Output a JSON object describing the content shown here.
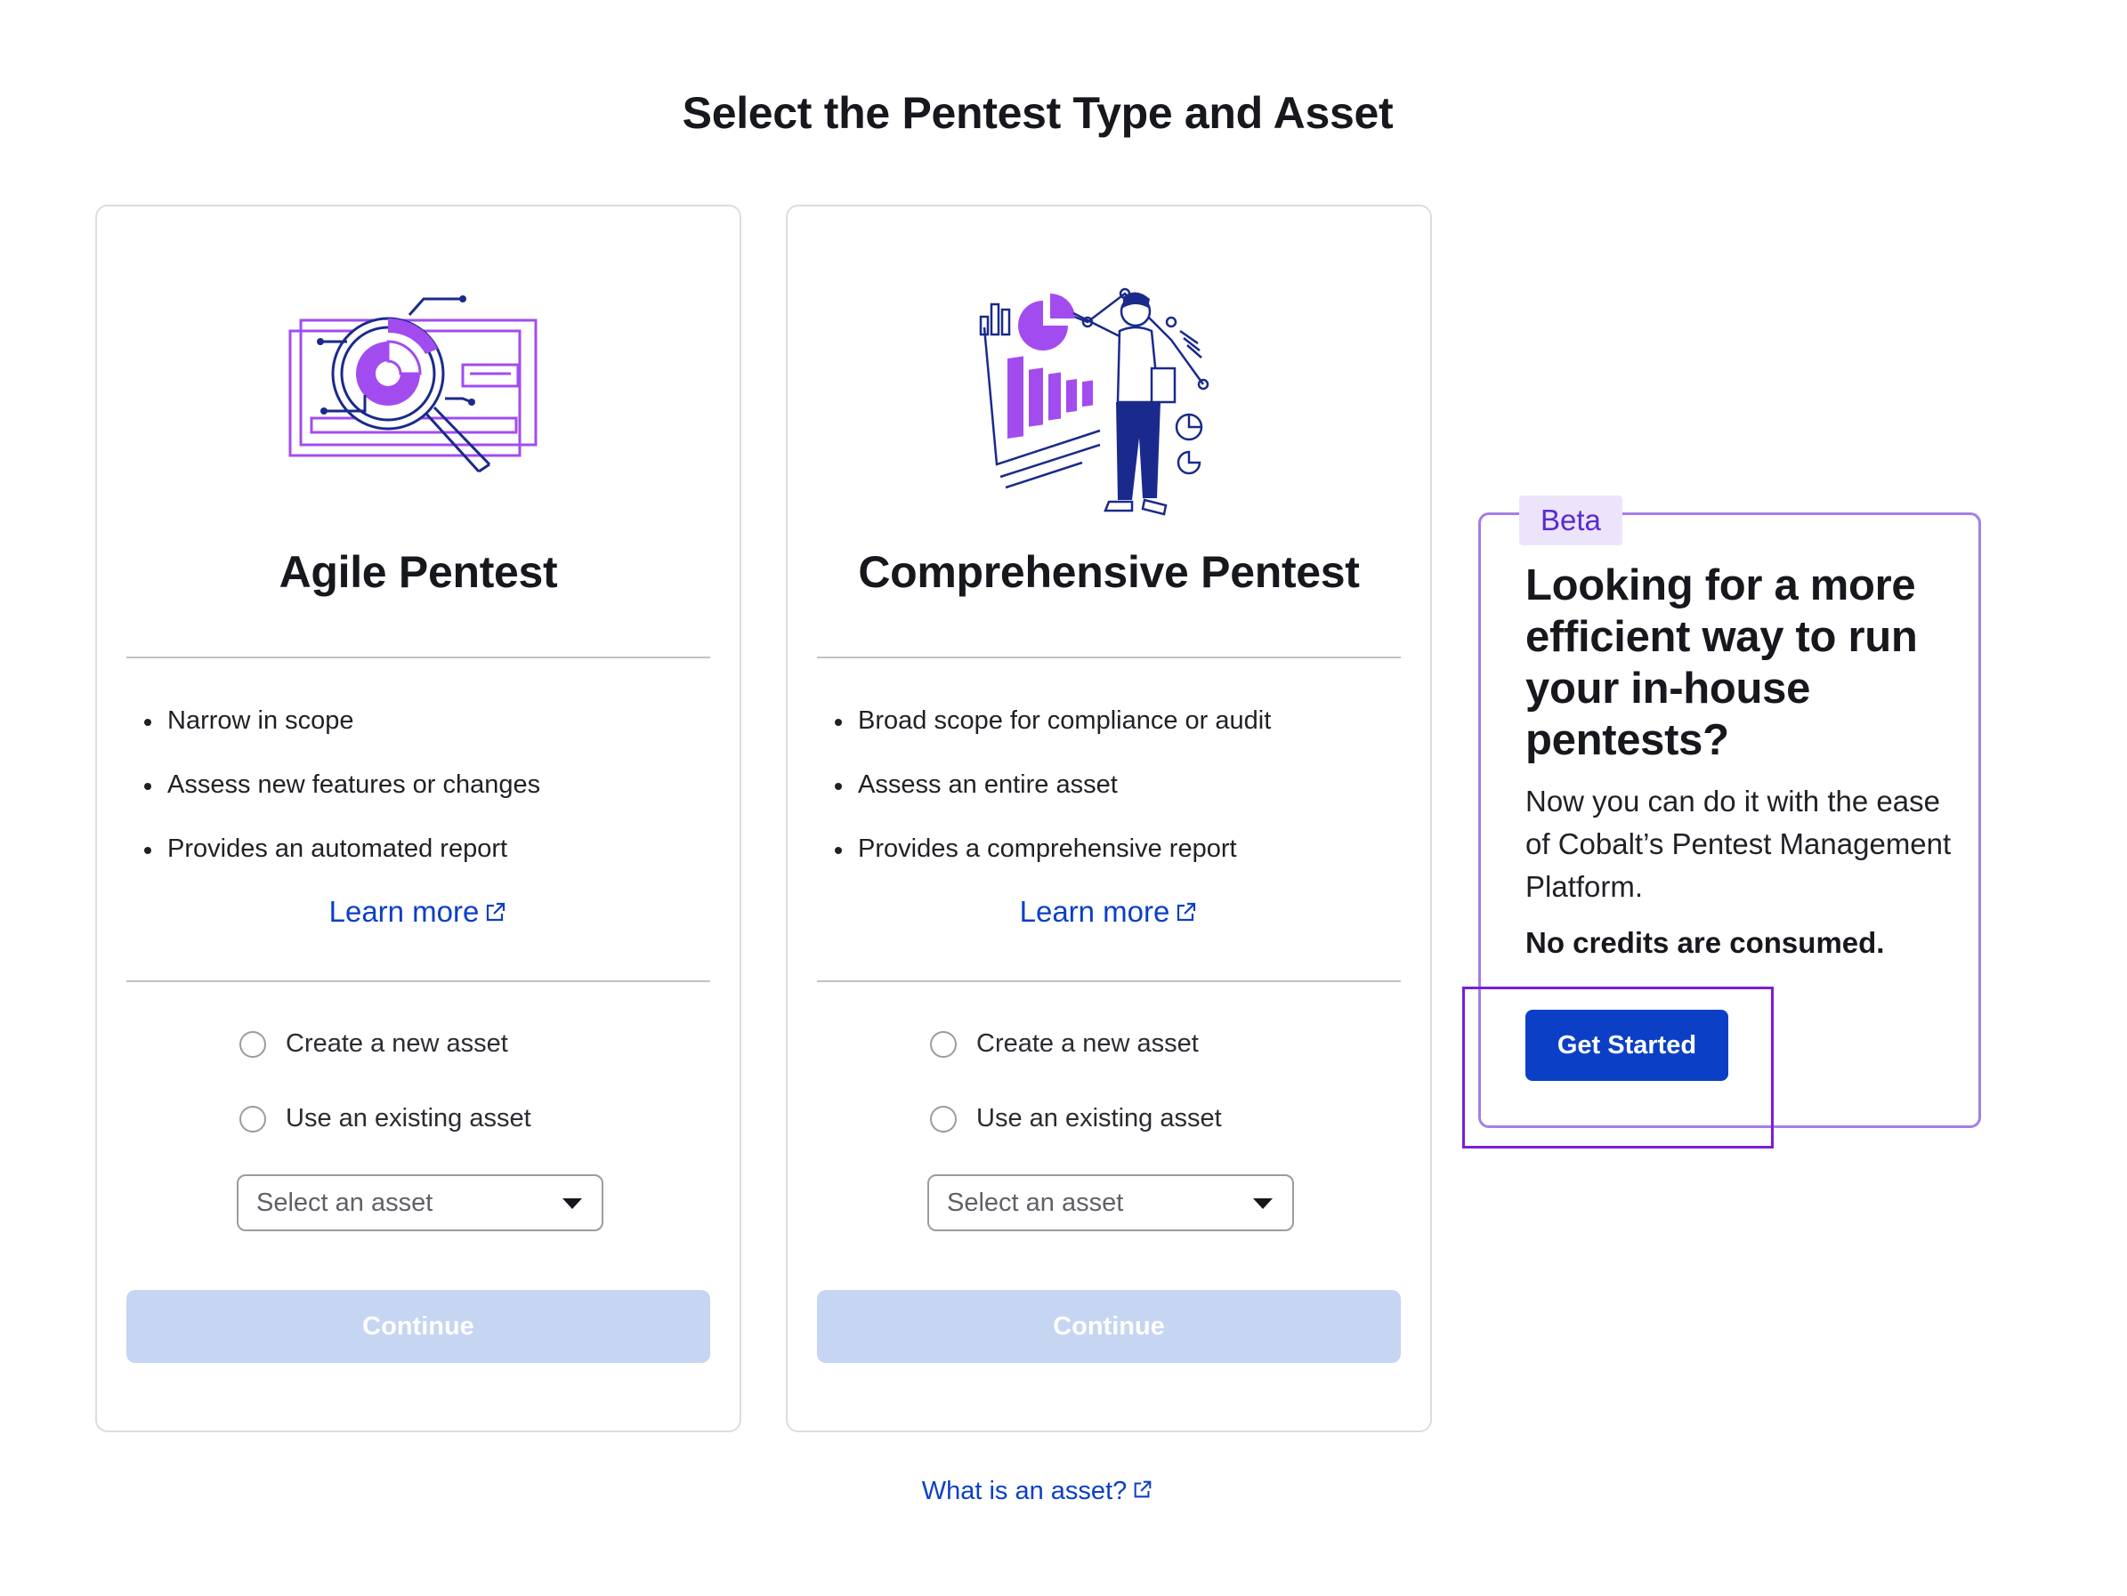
{
  "page": {
    "title": "Select the Pentest Type and Asset"
  },
  "cards": [
    {
      "title": "Agile Pentest",
      "features": [
        "Narrow in scope",
        "Assess new features or changes",
        "Provides an automated report"
      ],
      "learn_more": "Learn more",
      "radio_new": "Create a new asset",
      "radio_existing": "Use an existing asset",
      "select_placeholder": "Select an asset",
      "continue_label": "Continue"
    },
    {
      "title": "Comprehensive Pentest",
      "features": [
        "Broad scope for compliance or audit",
        "Assess an entire asset",
        "Provides a comprehensive report"
      ],
      "learn_more": "Learn more",
      "radio_new": "Create a new asset",
      "radio_existing": "Use an existing asset",
      "select_placeholder": "Select an asset",
      "continue_label": "Continue"
    }
  ],
  "promo": {
    "badge": "Beta",
    "heading": "Looking for a more efficient way to run your in-house pentests?",
    "description": "Now you can do it with the ease of Cobalt’s Pentest Management Platform.",
    "note": "No credits are consumed.",
    "button_label": "Get Started"
  },
  "footer": {
    "asset_link": "What is an asset?"
  },
  "colors": {
    "link": "#0b3fc6",
    "primary_button": "#0b3fc6",
    "disabled_button": "#c5d5f2",
    "illustration_purple": "#a24cf0",
    "illustration_navy": "#1a2a8c",
    "promo_border": "#a47ee8",
    "highlight": "#7a1ed8"
  }
}
